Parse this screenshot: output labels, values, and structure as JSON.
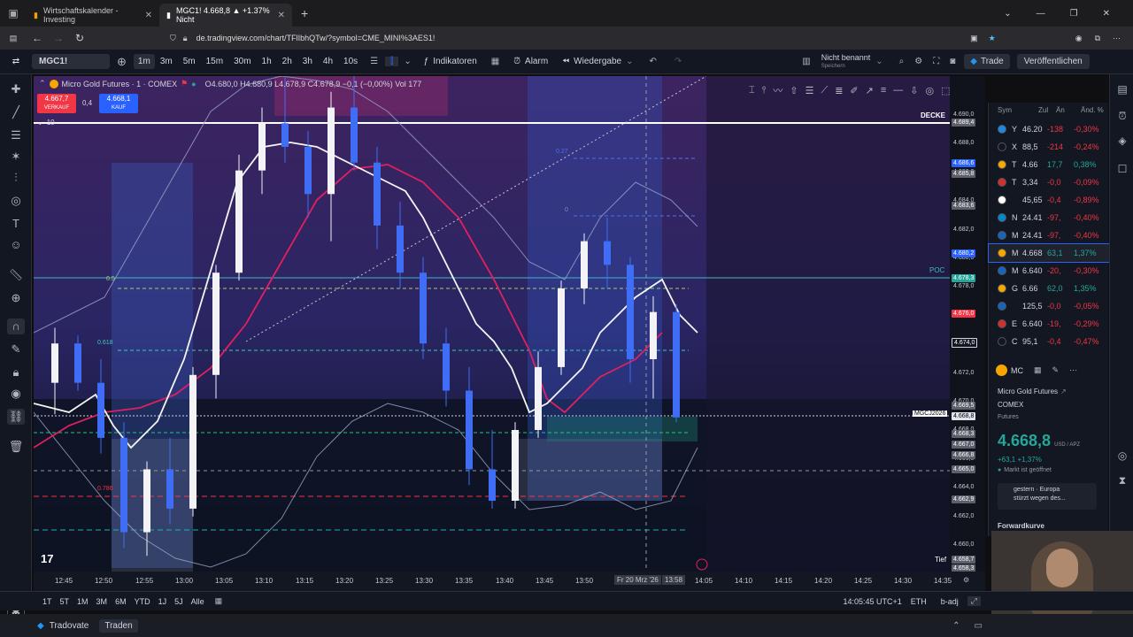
{
  "browser": {
    "tabs": [
      {
        "label": "Wirtschaftskalender - Investing"
      },
      {
        "label": "MGC1! 4.668,8 ▲ +1.37% Nicht"
      }
    ],
    "url": "de.tradingview.com/chart/TFlIbhQTw/?symbol=CME_MINI%3AES1!"
  },
  "toolbar": {
    "symbol": "MGC1!",
    "intervals": [
      "1m",
      "3m",
      "5m",
      "15m",
      "30m",
      "1h",
      "2h",
      "3h",
      "4h",
      "10s"
    ],
    "selected_interval": "1m",
    "indicators_label": "Indikatoren",
    "alarm_label": "Alarm",
    "replay_label": "Wiedergabe",
    "layout_name": "Nicht benannt",
    "layout_sub": "Speichern",
    "trade_label": "Trade",
    "publish_label": "Veröffentlichen"
  },
  "legend": {
    "title": "Micro Gold Futures · 1 · COMEX",
    "ohlc": "O4.680,0 H4.680,9 L4.678,9 C4.678,9 −0,1 (−0,00%) Vol 177",
    "sell_price": "4.667,7",
    "sell_label": "VERKAUF",
    "spread": "0,4",
    "buy_price": "4.668,1",
    "buy_label": "KAUF",
    "ind_value": "10"
  },
  "chart_labels": {
    "decke": "DECKE",
    "poc": "POC",
    "tief": "Tief",
    "contract_tag": "MGCJ2026",
    "fib_1": "0.5",
    "fib_2": "0.618",
    "fib_3": "0.786",
    "box_label_1": "0.27",
    "box_label_2": "0"
  },
  "y_axis": {
    "labels": [
      "4.690,0",
      "4.688,0",
      "4.686,0",
      "4.684,0",
      "4.682,0",
      "4.680,0",
      "4.678,0",
      "4.676,0",
      "4.674,0",
      "4.672,0",
      "4.670,0",
      "4.668,0",
      "4.666,0",
      "4.664,0",
      "4.662,0",
      "4.660,0"
    ],
    "tags": [
      {
        "text": "4.689,4",
        "color": "#5d606b"
      },
      {
        "text": "4.686,6",
        "color": "#2962ff"
      },
      {
        "text": "4.685,8",
        "color": "#5d606b"
      },
      {
        "text": "4.683,6",
        "color": "#5d606b"
      },
      {
        "text": "4.680,2",
        "color": "#2962ff"
      },
      {
        "text": "4.678,3",
        "color": "#26a69a"
      },
      {
        "text": "4.676,0",
        "color": "#f23645"
      },
      {
        "text": "4.674,0",
        "color": "#131722"
      },
      {
        "text": "4.669,5",
        "color": "#5d606b"
      },
      {
        "text": "4.668,8",
        "color": "#e0e3eb"
      },
      {
        "text": "4.668,3",
        "color": "#5d606b"
      },
      {
        "text": "4.667,0",
        "color": "#5d606b"
      },
      {
        "text": "4.666,8",
        "color": "#5d606b"
      },
      {
        "text": "4.665,0",
        "color": "#5d606b"
      },
      {
        "text": "4.662,9",
        "color": "#5d606b"
      },
      {
        "text": "4.658,7",
        "color": "#5d606b"
      },
      {
        "text": "4.658,3",
        "color": "#5d606b"
      }
    ]
  },
  "x_axis": {
    "labels": [
      "12:45",
      "12:50",
      "12:55",
      "13:00",
      "13:05",
      "13:10",
      "13:15",
      "13:20",
      "13:25",
      "13:30",
      "13:35",
      "13:40",
      "13:45",
      "13:50",
      "Fr 20 Mrz '26",
      "13:58",
      "14:05",
      "14:10",
      "14:15",
      "14:20",
      "14:25",
      "14:30",
      "14:35"
    ]
  },
  "bottom_bar": {
    "ranges": [
      "1T",
      "5T",
      "1M",
      "3M",
      "6M",
      "YTD",
      "1J",
      "5J",
      "Alle"
    ],
    "time": "14:05:45 UTC+1",
    "session": "ETH",
    "adj": "b-adj"
  },
  "status_bar": {
    "broker": "Tradovate",
    "trade_btn": "Traden"
  },
  "watchlist": {
    "headers": [
      "Sym",
      "Zul",
      "Än",
      "Änd. %"
    ],
    "rows": [
      {
        "sym": "Y",
        "last": "46.20",
        "chg": "-138",
        "pct": "-0,30%",
        "icon": "#1e88e5"
      },
      {
        "sym": "X",
        "last": "88,5",
        "chg": "-214",
        "pct": "-0,24%",
        "icon": "#131722"
      },
      {
        "sym": "T",
        "last": "4.66",
        "chg": "17,7",
        "pct": "0,38%",
        "icon": "#f7a600"
      },
      {
        "sym": "T",
        "last": "3,34",
        "chg": "-0,0",
        "pct": "-0,09%",
        "icon": "#d32f2f"
      },
      {
        "sym": "",
        "last": "45,65",
        "chg": "-0,4",
        "pct": "-0,89%",
        "icon": "#ffffff"
      },
      {
        "sym": "N",
        "last": "24.41",
        "chg": "-97,",
        "pct": "-0,40%",
        "icon": "#0288d1"
      },
      {
        "sym": "M",
        "last": "24.41",
        "chg": "-97,",
        "pct": "-0,40%",
        "icon": "#1565c0"
      },
      {
        "sym": "M",
        "last": "4.668",
        "chg": "63,1",
        "pct": "1,37%",
        "icon": "#f7a600"
      },
      {
        "sym": "M",
        "last": "6.640",
        "chg": "-20,",
        "pct": "-0,30%",
        "icon": "#1565c0"
      },
      {
        "sym": "G",
        "last": "6.66",
        "chg": "62,0",
        "pct": "1,35%",
        "icon": "#f7a600"
      },
      {
        "sym": "",
        "last": "125,5",
        "chg": "-0,0",
        "pct": "-0,05%",
        "icon": "#1565c0"
      },
      {
        "sym": "E",
        "last": "6.640",
        "chg": "-19,",
        "pct": "-0,29%",
        "icon": "#d32f2f"
      },
      {
        "sym": "C",
        "last": "95,1",
        "chg": "-0,4",
        "pct": "-0,47%",
        "icon": "#131722"
      }
    ]
  },
  "details": {
    "short_sym": "MC",
    "name": "Micro Gold Futures",
    "exchange": "COMEX",
    "type": "Futures",
    "price": "4.668,8",
    "unit": "USD / APZ",
    "change": "+63,1 +1,37%",
    "market": "Markt ist geöffnet",
    "news_1": "gestern · Europa",
    "news_2": "stürzt wegen des...",
    "forward": "Forwardkurve"
  },
  "chart_data": {
    "type": "candlestick",
    "timeframe": "1m",
    "y_range": [
      4659,
      4690.5
    ],
    "candles": [
      {
        "o": 4671.0,
        "h": 4674.5,
        "l": 4669.0,
        "c": 4673.5
      },
      {
        "o": 4673.5,
        "h": 4674.0,
        "l": 4670.5,
        "c": 4671.0
      },
      {
        "o": 4671.0,
        "h": 4672.5,
        "l": 4666.5,
        "c": 4667.5
      },
      {
        "o": 4667.5,
        "h": 4668.5,
        "l": 4660.5,
        "c": 4661.5
      },
      {
        "o": 4661.5,
        "h": 4666.0,
        "l": 4660.0,
        "c": 4665.5
      },
      {
        "o": 4665.5,
        "h": 4667.5,
        "l": 4662.0,
        "c": 4663.0
      },
      {
        "o": 4663.0,
        "h": 4672.0,
        "l": 4662.5,
        "c": 4671.5
      },
      {
        "o": 4671.5,
        "h": 4678.5,
        "l": 4670.0,
        "c": 4678.0
      },
      {
        "o": 4678.0,
        "h": 4685.5,
        "l": 4677.5,
        "c": 4684.5
      },
      {
        "o": 4684.5,
        "h": 4688.5,
        "l": 4683.0,
        "c": 4687.5
      },
      {
        "o": 4687.5,
        "h": 4690.5,
        "l": 4685.0,
        "c": 4686.0
      },
      {
        "o": 4686.0,
        "h": 4687.0,
        "l": 4681.5,
        "c": 4683.0
      },
      {
        "o": 4683.0,
        "h": 4689.5,
        "l": 4680.0,
        "c": 4688.5
      },
      {
        "o": 4688.5,
        "h": 4690.5,
        "l": 4684.5,
        "c": 4685.0
      },
      {
        "o": 4685.0,
        "h": 4686.0,
        "l": 4679.5,
        "c": 4681.0
      },
      {
        "o": 4681.0,
        "h": 4682.5,
        "l": 4677.0,
        "c": 4678.0
      },
      {
        "o": 4678.0,
        "h": 4679.0,
        "l": 4672.5,
        "c": 4673.5
      },
      {
        "o": 4673.5,
        "h": 4674.5,
        "l": 4669.5,
        "c": 4670.5
      },
      {
        "o": 4670.5,
        "h": 4672.0,
        "l": 4664.5,
        "c": 4665.5
      },
      {
        "o": 4665.5,
        "h": 4668.0,
        "l": 4663.0,
        "c": 4663.5
      },
      {
        "o": 4663.5,
        "h": 4668.5,
        "l": 4663.0,
        "c": 4668.0
      },
      {
        "o": 4668.0,
        "h": 4673.0,
        "l": 4667.5,
        "c": 4672.0
      },
      {
        "o": 4672.0,
        "h": 4677.5,
        "l": 4671.5,
        "c": 4677.0
      },
      {
        "o": 4677.0,
        "h": 4680.5,
        "l": 4676.0,
        "c": 4680.0
      },
      {
        "o": 4680.0,
        "h": 4681.5,
        "l": 4677.0,
        "c": 4678.5
      },
      {
        "o": 4678.5,
        "h": 4679.0,
        "l": 4671.0,
        "c": 4672.5
      },
      {
        "o": 4672.5,
        "h": 4676.5,
        "l": 4670.0,
        "c": 4675.5
      },
      {
        "o": 4675.5,
        "h": 4676.0,
        "l": 4668.5,
        "c": 4668.8
      }
    ]
  }
}
